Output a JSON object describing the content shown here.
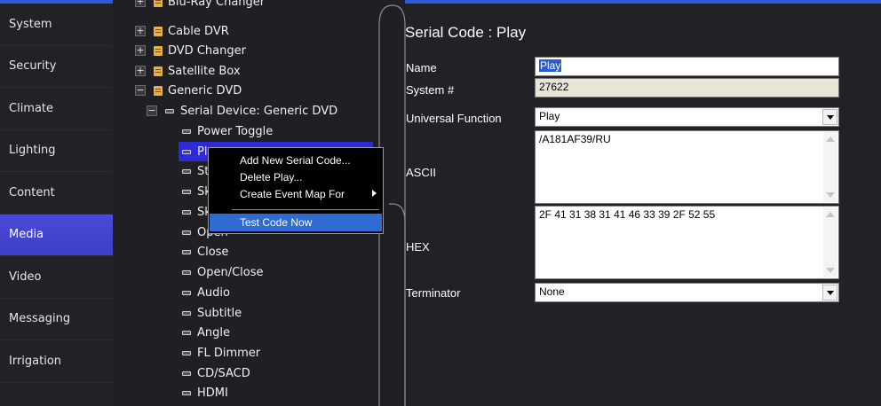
{
  "nav": {
    "items": [
      {
        "label": "System"
      },
      {
        "label": "Security"
      },
      {
        "label": "Climate"
      },
      {
        "label": "Lighting"
      },
      {
        "label": "Content"
      },
      {
        "label": "Media"
      },
      {
        "label": "Video"
      },
      {
        "label": "Messaging"
      },
      {
        "label": "Irrigation"
      }
    ],
    "active": "Media"
  },
  "tree": {
    "devices": [
      {
        "label": "Blu-Ray Changer"
      },
      {
        "label": "Cable DVR"
      },
      {
        "label": "DVD Changer"
      },
      {
        "label": "Satellite Box"
      },
      {
        "label": "Generic DVD"
      }
    ],
    "serial_device": "Serial Device: Generic DVD",
    "codes": [
      {
        "label": "Power Toggle"
      },
      {
        "label": "Play"
      },
      {
        "label": "Stop"
      },
      {
        "label": "Skip"
      },
      {
        "label": "Skip"
      },
      {
        "label": "Open"
      },
      {
        "label": "Close"
      },
      {
        "label": "Open/Close"
      },
      {
        "label": "Audio"
      },
      {
        "label": "Subtitle"
      },
      {
        "label": "Angle"
      },
      {
        "label": "FL Dimmer"
      },
      {
        "label": "CD/SACD"
      },
      {
        "label": "HDMI"
      }
    ]
  },
  "context_menu": {
    "items": [
      {
        "label": "Add New Serial Code..."
      },
      {
        "label": "Delete Play..."
      },
      {
        "label": "Create Event Map For"
      },
      {
        "label": "Test Code Now"
      }
    ]
  },
  "panel": {
    "title": "Serial Code : Play",
    "name_label": "Name",
    "name_value": "Play",
    "system_label": "System #",
    "system_value": "27622",
    "uf_label": "Universal Function",
    "uf_value": "Play",
    "ascii_label": "ASCII",
    "ascii_value": "/A181AF39/RU",
    "hex_label": "HEX",
    "hex_value": "2F 41 31 38 31 41 46 33 39 2F 52 55",
    "term_label": "Terminator",
    "term_value": "None"
  },
  "colors": {
    "accent": "#2b5bd7",
    "active_nav": "#4a4bd6",
    "selection": "#2d2ad6",
    "menu_highlight": "#2f6bd0"
  }
}
